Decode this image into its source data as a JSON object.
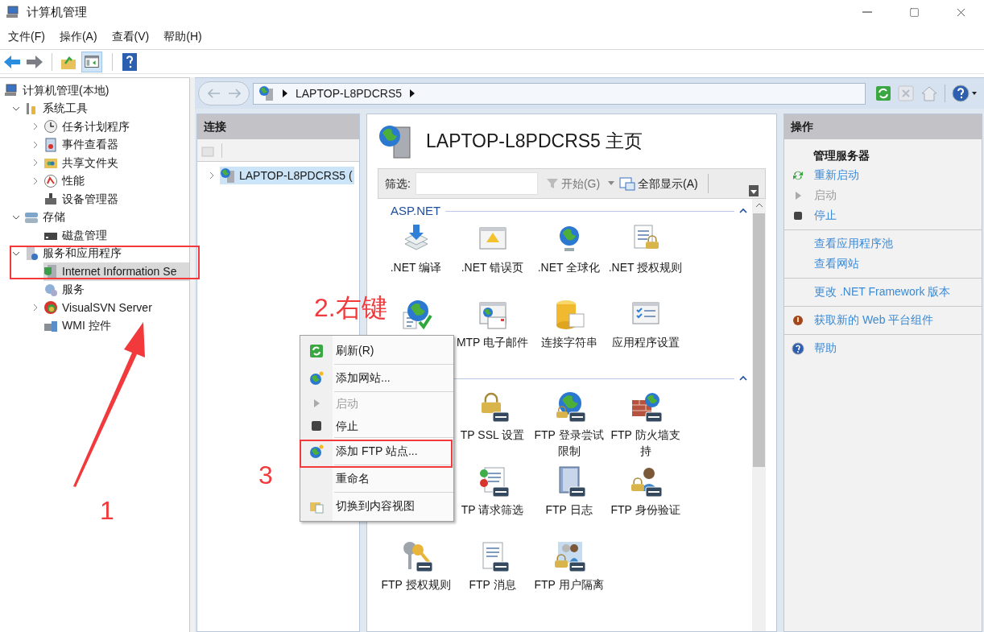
{
  "window": {
    "title": "计算机管理"
  },
  "menu_bar": [
    "文件(F)",
    "操作(A)",
    "查看(V)",
    "帮助(H)"
  ],
  "tree": {
    "label": "计算机管理(本地)",
    "selected": false,
    "children": [
      {
        "label": "系统工具",
        "expanded": true,
        "selected": false,
        "children": [
          {
            "label": "任务计划程序",
            "expanded": false,
            "selected": false
          },
          {
            "label": "事件查看器",
            "expanded": false,
            "selected": false
          },
          {
            "label": "共享文件夹",
            "expanded": false,
            "selected": false
          },
          {
            "label": "性能",
            "expanded": false,
            "selected": false
          },
          {
            "label": "设备管理器",
            "selected": false
          }
        ]
      },
      {
        "label": "存储",
        "expanded": true,
        "selected": false,
        "children": [
          {
            "label": "磁盘管理",
            "selected": false
          }
        ]
      },
      {
        "label": "服务和应用程序",
        "expanded": true,
        "selected": false,
        "children": [
          {
            "label": "Internet Information Se",
            "selected": true
          },
          {
            "label": "服务",
            "selected": false
          },
          {
            "label": "VisualSVN Server",
            "expanded": false,
            "selected": false
          },
          {
            "label": "WMI 控件",
            "selected": false
          }
        ]
      }
    ]
  },
  "address_bar": {
    "path": [
      "LAPTOP-L8PDCRS5"
    ]
  },
  "connections": {
    "title": "连接",
    "items": [
      {
        "label": "LAPTOP-L8PDCRS5 (",
        "expanded": false,
        "selected": true
      }
    ]
  },
  "home": {
    "title": "LAPTOP-L8PDCRS5 主页",
    "filter": {
      "label": "筛选:",
      "go": "开始(G)",
      "show_all": "全部显示(A)"
    },
    "groups": [
      {
        "title": "ASP.NET",
        "rows": [
          [
            {
              "label": ".NET 编译"
            },
            {
              "label": ".NET 错误页"
            },
            {
              "label": ".NET 全球化"
            },
            {
              "label": ".NET 授权规则"
            }
          ],
          [
            {},
            {
              "label": "MTP 电子邮件"
            },
            {
              "label": "连接字符串"
            },
            {
              "label": "应用程序设置"
            }
          ]
        ]
      },
      {
        "rows": [
          [
            null,
            {
              "label": "TP SSL 设置"
            },
            {
              "label": "FTP 登录尝试限制"
            },
            {
              "label": "FTP 防火墙支持"
            }
          ],
          [
            null,
            {
              "label": "TP 请求筛选"
            },
            {
              "label": "FTP 日志"
            },
            {
              "label": "FTP 身份验证"
            }
          ],
          [
            {
              "label": "FTP 授权规则"
            },
            {
              "label": "FTP 消息"
            },
            {
              "label": "FTP 用户隔离"
            }
          ]
        ]
      }
    ]
  },
  "actions": {
    "title": "操作",
    "heading": "管理服务器",
    "groups": [
      [
        {
          "label": "重新启动",
          "disabled": false
        },
        {
          "label": "启动",
          "disabled": true
        },
        {
          "label": "停止",
          "disabled": false
        }
      ],
      [
        {
          "label": "查看应用程序池",
          "disabled": false
        },
        {
          "label": "查看网站",
          "disabled": false
        }
      ],
      [
        {
          "label": "更改 .NET Framework 版本",
          "disabled": false
        }
      ],
      [
        {
          "label": "获取新的 Web 平台组件",
          "disabled": false
        }
      ],
      [
        {
          "label": "帮助",
          "disabled": false
        }
      ]
    ]
  },
  "context_menu": {
    "groups": [
      [
        {
          "label": "刷新(R)",
          "disabled": false
        }
      ],
      [
        {
          "label": "添加网站...",
          "disabled": false
        }
      ],
      [
        {
          "label": "启动",
          "disabled": true
        },
        {
          "label": "停止",
          "disabled": false
        }
      ],
      [
        {
          "label": "添加 FTP 站点...",
          "disabled": false
        }
      ],
      [
        {
          "label": "重命名",
          "disabled": false
        }
      ],
      [
        {
          "label": "切换到内容视图",
          "disabled": false
        }
      ]
    ]
  },
  "annotations": [
    {
      "text": "1"
    },
    {
      "text": "2.右键"
    },
    {
      "text": "3"
    }
  ]
}
